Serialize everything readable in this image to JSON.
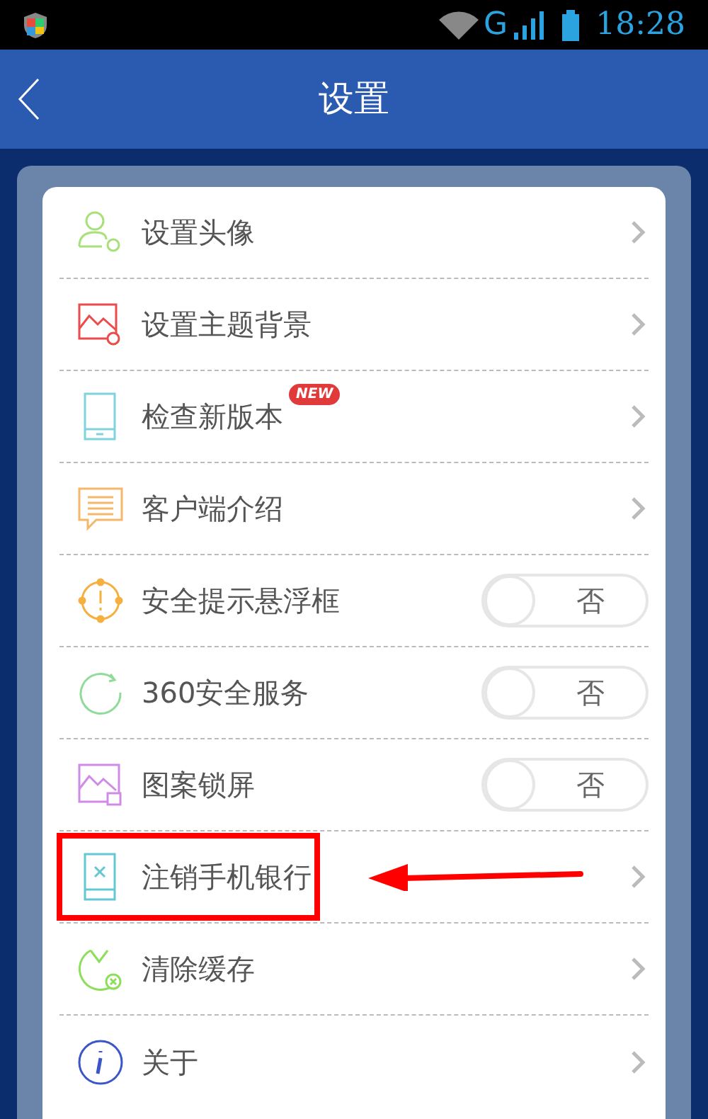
{
  "status_bar": {
    "network": "G",
    "time": "18:28"
  },
  "header": {
    "title": "设置"
  },
  "items": [
    {
      "kind": "link",
      "label": "设置头像",
      "annotated": false
    },
    {
      "kind": "link",
      "label": "设置主题背景",
      "annotated": false
    },
    {
      "kind": "link",
      "label": "检查新版本",
      "badge": "NEW",
      "annotated": false
    },
    {
      "kind": "link",
      "label": "客户端介绍",
      "annotated": false
    },
    {
      "kind": "toggle",
      "label": "安全提示悬浮框",
      "on": false,
      "state_label": "否",
      "annotated": false
    },
    {
      "kind": "toggle",
      "label": "360安全服务",
      "on": false,
      "state_label": "否",
      "annotated": false
    },
    {
      "kind": "toggle",
      "label": "图案锁屏",
      "on": false,
      "state_label": "否",
      "annotated": false
    },
    {
      "kind": "link",
      "label": "注销手机银行",
      "annotated": true
    },
    {
      "kind": "link",
      "label": "清除缓存",
      "annotated": false
    },
    {
      "kind": "link",
      "label": "关于",
      "annotated": false
    }
  ]
}
